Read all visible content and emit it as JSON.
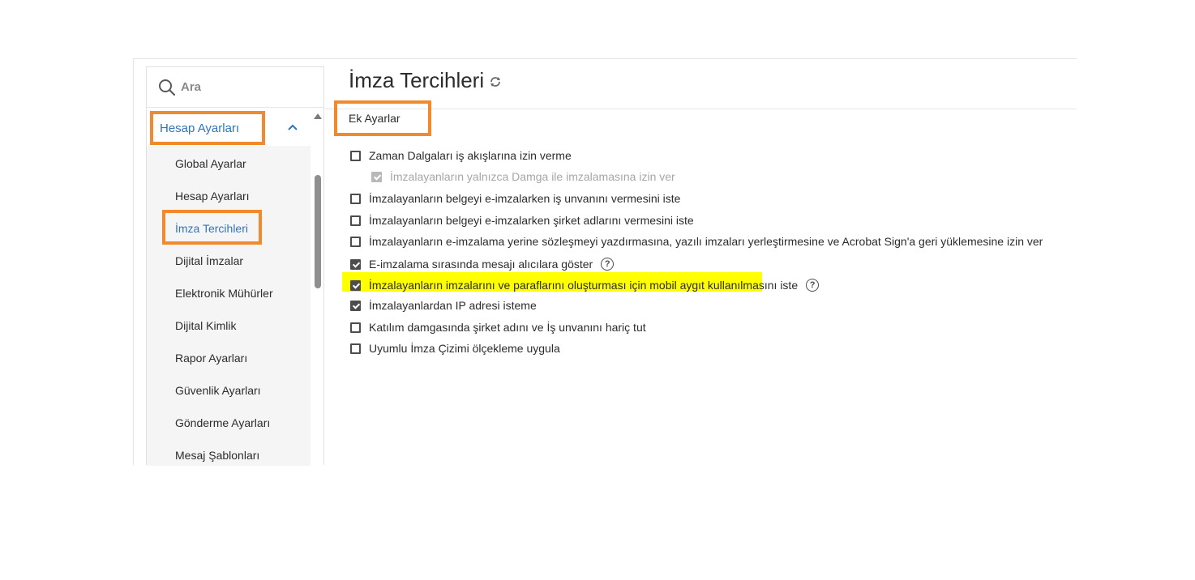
{
  "search": {
    "placeholder": "Ara"
  },
  "sidebar": {
    "section_label": "Hesap Ayarları",
    "items": [
      {
        "label": "Global Ayarlar"
      },
      {
        "label": "Hesap Ayarları"
      },
      {
        "label": "İmza Tercihleri",
        "active": true
      },
      {
        "label": "Dijital İmzalar"
      },
      {
        "label": "Elektronik Mühürler"
      },
      {
        "label": "Dijital Kimlik"
      },
      {
        "label": "Rapor Ayarları"
      },
      {
        "label": "Güvenlik Ayarları"
      },
      {
        "label": "Gönderme Ayarları"
      },
      {
        "label": "Mesaj Şablonları"
      }
    ]
  },
  "main": {
    "title": "İmza Tercihleri",
    "group_title": "Ek Ayarlar",
    "options": [
      {
        "label": "Zaman Dalgaları iş akışlarına izin verme",
        "checked": false
      },
      {
        "label": "İmzalayanların yalnızca Damga ile imzalamasına izin ver",
        "checked": true,
        "disabled": true
      },
      {
        "label": "İmzalayanların belgeyi e-imzalarken iş unvanını vermesini iste",
        "checked": false
      },
      {
        "label": "İmzalayanların belgeyi e-imzalarken şirket adlarını vermesini iste",
        "checked": false
      },
      {
        "label": "İmzalayanların e-imzalama yerine sözleşmeyi yazdırmasına, yazılı imzaları yerleştirmesine ve Acrobat Sign'a geri yüklemesine izin ver",
        "checked": false
      },
      {
        "label": "E-imzalama sırasında mesajı alıcılara göster",
        "checked": true,
        "help": "?"
      },
      {
        "label": "İmzalayanların imzalarını ve paraflarını oluşturması için mobil aygıt kullanılmasını iste",
        "checked": true,
        "help": "?",
        "highlighted": true
      },
      {
        "label": "İmzalayanlardan IP adresi isteme",
        "checked": true
      },
      {
        "label": "Katılım damgasında şirket adını ve İş unvanını hariç tut",
        "checked": false
      },
      {
        "label": "Uyumlu İmza Çizimi ölçekleme uygula",
        "checked": false
      }
    ]
  },
  "colors": {
    "accent": "#2d75c2",
    "callout": "#f08a2c",
    "highlight": "#ffff00"
  }
}
